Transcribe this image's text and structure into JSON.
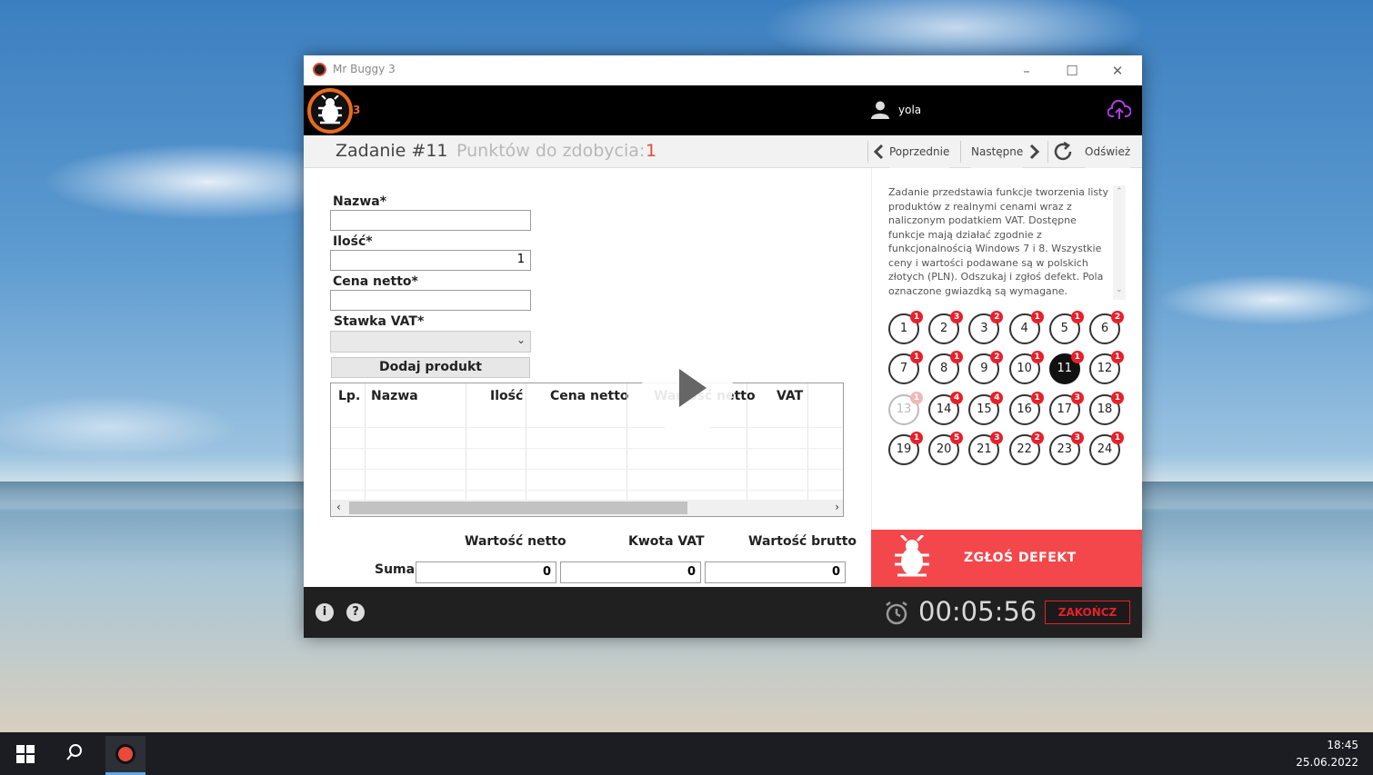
{
  "window": {
    "title": "Mr Buggy 3",
    "minimize": "–",
    "maximize": "☐",
    "close": "✕"
  },
  "header": {
    "logo_mark": "3",
    "username": "yola"
  },
  "subbar": {
    "task_title": "Zadanie #11",
    "points_label": "Punktów do zdobycia:",
    "points_value": "1",
    "prev": "Poprzednie",
    "next": "Następne",
    "refresh": "Odśwież"
  },
  "form": {
    "name_label": "Nazwa*",
    "name_value": "",
    "qty_label": "Ilość*",
    "qty_value": "1",
    "price_label": "Cena netto*",
    "price_value": "",
    "vat_label": "Stawka VAT*",
    "vat_value": "",
    "add_button": "Dodaj produkt"
  },
  "table": {
    "columns": [
      "Lp.",
      "Nazwa",
      "Ilość",
      "Cena netto",
      "Wartość netto",
      "VAT"
    ],
    "rows": []
  },
  "totals": {
    "net_label": "Wartość netto",
    "vat_label": "Kwota VAT",
    "gross_label": "Wartość brutto",
    "sum_label": "Suma",
    "net_value": "0",
    "vat_value": "0",
    "gross_value": "0"
  },
  "description": "Zadanie przedstawia funkcje tworzenia listy produktów z realnymi cenami wraz z naliczonym podatkiem VAT. Dostępne funkcje mają działać zgodnie z funkcjonalnością Windows 7 i 8. Wszystkie ceny i wartości podawane są w polskich złotych (PLN). Odszukaj i zgłoś defekt. Pola oznaczone gwiazdką są wymagane.",
  "tasks": [
    {
      "n": "1",
      "badge": "1"
    },
    {
      "n": "2",
      "badge": "3"
    },
    {
      "n": "3",
      "badge": "2"
    },
    {
      "n": "4",
      "badge": "1"
    },
    {
      "n": "5",
      "badge": "1"
    },
    {
      "n": "6",
      "badge": "2"
    },
    {
      "n": "7",
      "badge": "1"
    },
    {
      "n": "8",
      "badge": "1"
    },
    {
      "n": "9",
      "badge": "2"
    },
    {
      "n": "10",
      "badge": "1"
    },
    {
      "n": "11",
      "badge": "1",
      "active": true
    },
    {
      "n": "12",
      "badge": "1"
    },
    {
      "n": "13",
      "badge": "1",
      "faded": true
    },
    {
      "n": "14",
      "badge": "4"
    },
    {
      "n": "15",
      "badge": "4"
    },
    {
      "n": "16",
      "badge": "1"
    },
    {
      "n": "17",
      "badge": "3"
    },
    {
      "n": "18",
      "badge": "1"
    },
    {
      "n": "19",
      "badge": "1"
    },
    {
      "n": "20",
      "badge": "5"
    },
    {
      "n": "21",
      "badge": "3"
    },
    {
      "n": "22",
      "badge": "2"
    },
    {
      "n": "23",
      "badge": "3"
    },
    {
      "n": "24",
      "badge": "1"
    }
  ],
  "report": {
    "label": "ZGŁOŚ DEFEKT"
  },
  "footer": {
    "info": "i",
    "help": "?",
    "timer": "00:05:56",
    "end_button": "ZAKOŃCZ"
  },
  "taskbar": {
    "time": "18:45",
    "date": "25.06.2022"
  },
  "colors": {
    "accent_red": "#e8202a",
    "report_bg": "#f3474b",
    "logo_orange": "#e86a20",
    "cloud_purple": "#b13be8"
  }
}
